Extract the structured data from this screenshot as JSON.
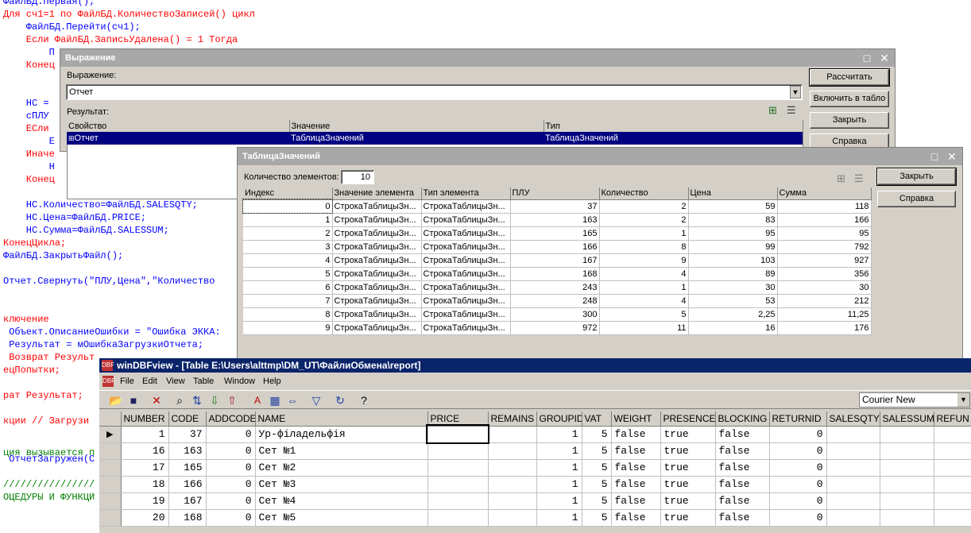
{
  "code": {
    "lines": [
      {
        "text": "ФайлБД.Первая();",
        "cls": "id"
      },
      {
        "text": "Для сч1=1 по ФайлБД.КоличествоЗаписей() цикл",
        "cls": "kw"
      },
      {
        "text": "    ФайлБД.Перейти(сч1);",
        "cls": "id"
      },
      {
        "text": "    Если ФайлБД.ЗаписьУдалена() = 1 Тогда",
        "cls": "kw"
      },
      {
        "text": "        П",
        "cls": "id"
      },
      {
        "text": "    Конец",
        "cls": "kw"
      },
      {
        "text": "    НС =",
        "cls": "id"
      },
      {
        "text": "    сПЛУ",
        "cls": "id"
      },
      {
        "text": "    ЕСли",
        "cls": "kw"
      },
      {
        "text": "        Е",
        "cls": "id"
      },
      {
        "text": "    Иначе",
        "cls": "kw"
      },
      {
        "text": "        Н",
        "cls": "id"
      },
      {
        "text": "    Конец",
        "cls": "kw"
      },
      {
        "text": "    НС.Количество=ФайлБД.SALESQTY;",
        "cls": "id"
      },
      {
        "text": "    НС.Цена=ФайлБД.PRICE;",
        "cls": "id"
      },
      {
        "text": "    НС.Сумма=ФайлБД.SALESSUM;",
        "cls": "id"
      },
      {
        "text": "КонецЦикла;",
        "cls": "kw"
      },
      {
        "text": "ФайлБД.ЗакрытьФайл();",
        "cls": "id"
      },
      {
        "text": "Отчет.Свернуть(\"ПЛУ,Цена\",\"Количество",
        "cls": "id"
      },
      {
        "text": "ключение",
        "cls": "kw"
      },
      {
        "text": " Объект.ОписаниеОшибки = \"Ошибка ЭККА:",
        "cls": "id"
      },
      {
        "text": " Результат = мОшибкаЗагрузкиОтчета;",
        "cls": "id"
      },
      {
        "text": " Возврат Результ",
        "cls": "kw"
      },
      {
        "text": "ецПопытки;",
        "cls": "kw"
      },
      {
        "text": "рат Результат;",
        "cls": "kw"
      },
      {
        "text": "кции // Загрузи",
        "cls": "kw"
      },
      {
        "text": "ция вызывается п",
        "cls": "cm"
      },
      {
        "text": " ОтчетЗагружен(С",
        "cls": "id"
      },
      {
        "text": "////////////////",
        "cls": "cm"
      },
      {
        "text": "ОЦЕДУРЫ И ФУНКЦИ",
        "cls": "cm"
      }
    ]
  },
  "expression_window": {
    "title": "Выражение",
    "expression_label": "Выражение:",
    "expression_value": "Отчет",
    "result_label": "Результат:",
    "buttons": {
      "calculate": "Рассчитать",
      "to_table": "Включить в табло",
      "close": "Закрыть",
      "help": "Справка"
    },
    "columns": [
      "Свойство",
      "Значение",
      "Тип"
    ],
    "row": {
      "property": "Отчет",
      "value": "ТаблицаЗначений",
      "type": "ТаблицаЗначений"
    }
  },
  "value_table_window": {
    "title": "ТаблицаЗначений",
    "count_label": "Количество элементов:",
    "count_value": "10",
    "buttons": {
      "close": "Закрыть",
      "help": "Справка"
    },
    "columns": [
      "Индекс",
      "Значение элемента",
      "Тип элемента",
      "ПЛУ",
      "Количество",
      "Цена",
      "Сумма"
    ],
    "rows": [
      [
        "0",
        "СтрокаТаблицыЗн...",
        "СтрокаТаблицыЗн...",
        "37",
        "2",
        "59",
        "118"
      ],
      [
        "1",
        "СтрокаТаблицыЗн...",
        "СтрокаТаблицыЗн...",
        "163",
        "2",
        "83",
        "166"
      ],
      [
        "2",
        "СтрокаТаблицыЗн...",
        "СтрокаТаблицыЗн...",
        "165",
        "1",
        "95",
        "95"
      ],
      [
        "3",
        "СтрокаТаблицыЗн...",
        "СтрокаТаблицыЗн...",
        "166",
        "8",
        "99",
        "792"
      ],
      [
        "4",
        "СтрокаТаблицыЗн...",
        "СтрокаТаблицыЗн...",
        "167",
        "9",
        "103",
        "927"
      ],
      [
        "5",
        "СтрокаТаблицыЗн...",
        "СтрокаТаблицыЗн...",
        "168",
        "4",
        "89",
        "356"
      ],
      [
        "6",
        "СтрокаТаблицыЗн...",
        "СтрокаТаблицыЗн...",
        "243",
        "1",
        "30",
        "30"
      ],
      [
        "7",
        "СтрокаТаблицыЗн...",
        "СтрокаТаблицыЗн...",
        "248",
        "4",
        "53",
        "212"
      ],
      [
        "8",
        "СтрокаТаблицыЗн...",
        "СтрокаТаблицыЗн...",
        "300",
        "5",
        "2,25",
        "11,25"
      ],
      [
        "9",
        "СтрокаТаблицыЗн...",
        "СтрокаТаблицыЗн...",
        "972",
        "11",
        "16",
        "176"
      ]
    ]
  },
  "dbf_window": {
    "title": "winDBFview - [Table E:\\Users\\alttmp\\DM_UT\\ФайлиОбмена\\report]",
    "menu": [
      "File",
      "Edit",
      "View",
      "Table",
      "Window",
      "Help"
    ],
    "font_select": "Courier New",
    "columns": [
      "NUMBER",
      "CODE",
      "ADDCODE",
      "NAME",
      "PRICE",
      "REMAINS",
      "GROUPID",
      "VAT",
      "WEIGHT",
      "PRESENCE",
      "BLOCKING",
      "RETURNID",
      "SALESQTY",
      "SALESSUM",
      "REFUN"
    ],
    "rows": [
      [
        "1",
        "37",
        "0",
        "Ур-філадельфія",
        "",
        "",
        "1",
        "5",
        "false",
        "true",
        "false",
        "0",
        "",
        "",
        ""
      ],
      [
        "16",
        "163",
        "0",
        "Сет №1",
        "",
        "",
        "1",
        "5",
        "false",
        "true",
        "false",
        "0",
        "",
        "",
        ""
      ],
      [
        "17",
        "165",
        "0",
        "Сет №2",
        "",
        "",
        "1",
        "5",
        "false",
        "true",
        "false",
        "0",
        "",
        "",
        ""
      ],
      [
        "18",
        "166",
        "0",
        "Сет №3",
        "",
        "",
        "1",
        "5",
        "false",
        "true",
        "false",
        "0",
        "",
        "",
        ""
      ],
      [
        "19",
        "167",
        "0",
        "Сет №4",
        "",
        "",
        "1",
        "5",
        "false",
        "true",
        "false",
        "0",
        "",
        "",
        ""
      ],
      [
        "20",
        "168",
        "0",
        "Сет №5",
        "",
        "",
        "1",
        "5",
        "false",
        "true",
        "false",
        "0",
        "",
        "",
        ""
      ]
    ]
  }
}
